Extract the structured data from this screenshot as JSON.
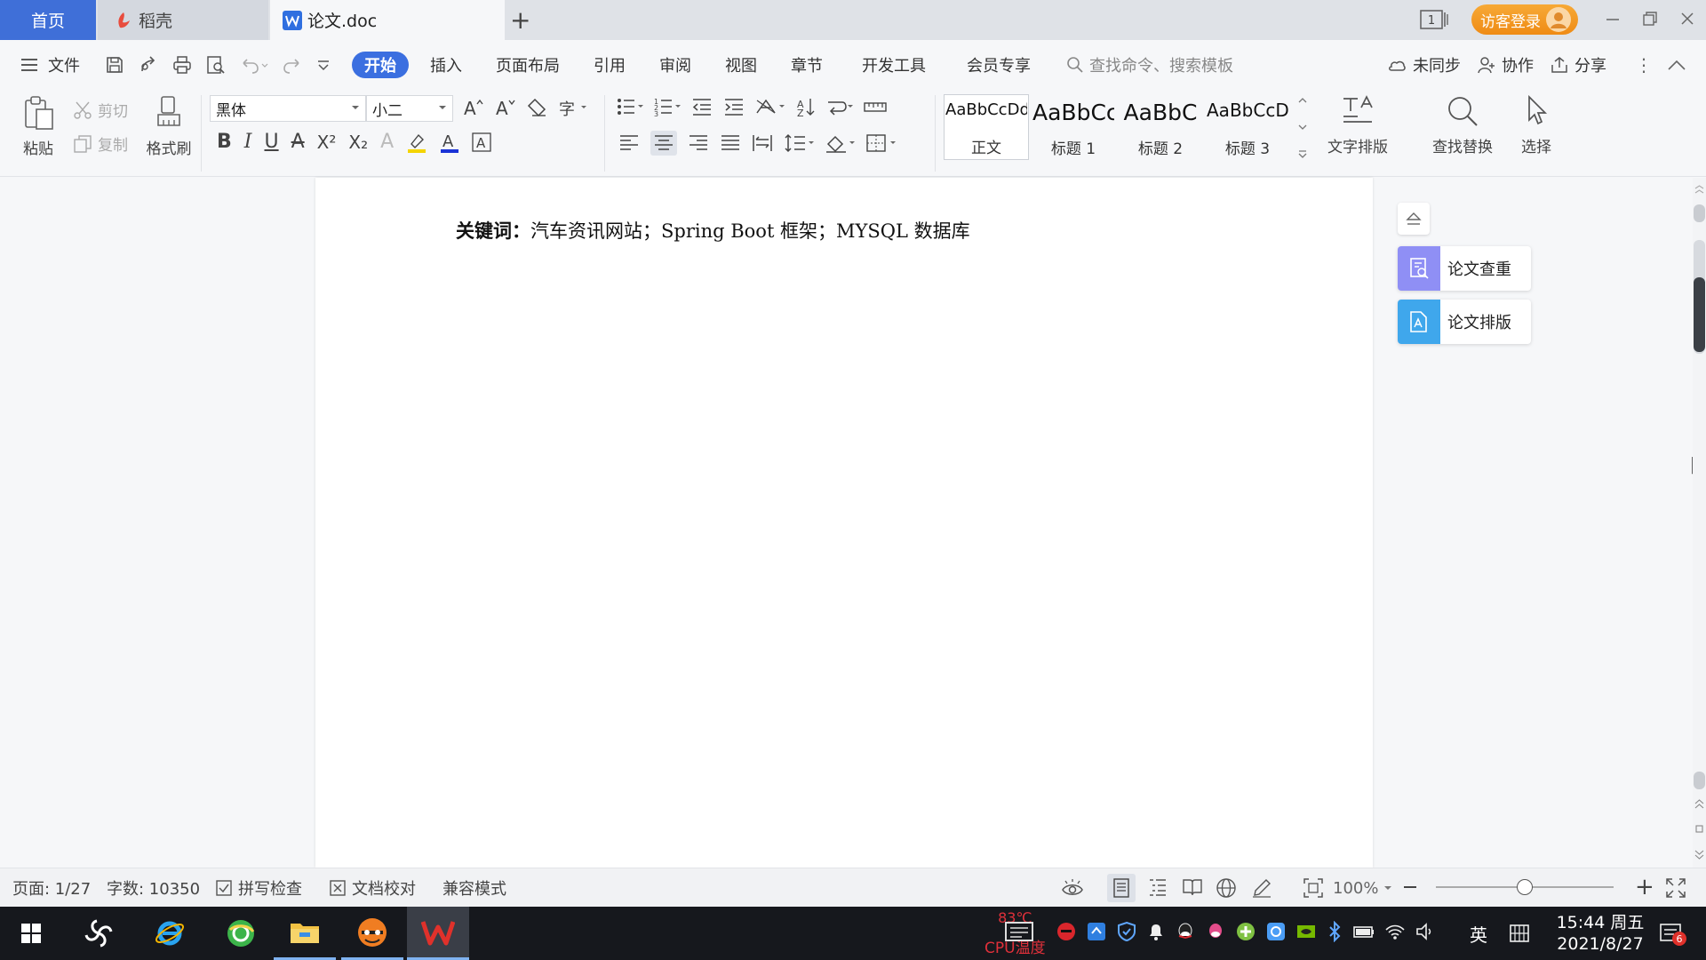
{
  "titlebar": {
    "tabs": [
      {
        "label": "首页"
      },
      {
        "label": "稻壳"
      },
      {
        "label": "论文.doc"
      }
    ],
    "login_label": "访客登录",
    "page_indicator": "1"
  },
  "menu": {
    "file_label": "文件",
    "items": [
      "开始",
      "插入",
      "页面布局",
      "引用",
      "审阅",
      "视图",
      "章节",
      "开发工具",
      "会员专享"
    ],
    "search_placeholder": "查找命令、搜索模板",
    "sync_label": "未同步",
    "collab_label": "协作",
    "share_label": "分享"
  },
  "ribbon": {
    "paste_label": "粘贴",
    "cut_label": "剪切",
    "copy_label": "复制",
    "format_painter_label": "格式刷",
    "font_name": "黑体",
    "font_size": "小二",
    "styles": [
      {
        "preview": "AaBbCcDd",
        "name": "正文"
      },
      {
        "preview": "AaBbCc",
        "name": "标题 1"
      },
      {
        "preview": "AaBbC",
        "name": "标题 2"
      },
      {
        "preview": "AaBbCcD",
        "name": "标题 3"
      }
    ],
    "text_layout_label": "文字排版",
    "find_replace_label": "查找替换",
    "select_label": "选择"
  },
  "document": {
    "keywords_label": "关键词：",
    "keywords_text": "汽车资讯网站；Spring Boot 框架；MYSQL 数据库"
  },
  "side_panel": {
    "check_label": "论文查重",
    "layout_label": "论文排版"
  },
  "status": {
    "page": "页面: 1/27",
    "words": "字数: 10350",
    "spell_check": "拼写检查",
    "proofread": "文档校对",
    "compat_mode": "兼容模式",
    "zoom": "100%",
    "zoom_level": 0.5
  },
  "taskbar": {
    "cpu_temp": "83℃",
    "cpu_label": "CPU温度",
    "ime_label": "英",
    "time": "15:44 周五",
    "date": "2021/8/27",
    "notification_count": "6"
  },
  "colors": {
    "accent": "#3b6fe0",
    "login": "#f39a22",
    "check_icon_bg": "#8f8ff5",
    "layout_icon_bg": "#3fa7ec"
  }
}
